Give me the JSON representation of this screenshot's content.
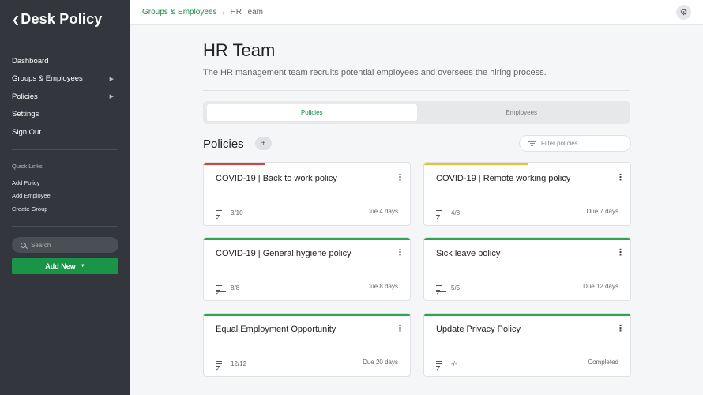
{
  "app": {
    "title": "Desk Policy"
  },
  "sidebar": {
    "nav": [
      {
        "label": "Dashboard",
        "has_children": false
      },
      {
        "label": "Groups & Employees",
        "has_children": true
      },
      {
        "label": "Policies",
        "has_children": true
      },
      {
        "label": "Settings",
        "has_children": false
      },
      {
        "label": "Sign Out",
        "has_children": false
      }
    ],
    "quick_links_title": "Quick Links",
    "quick_links": [
      "Add Policy",
      "Add Employee",
      "Create Group"
    ],
    "search_placeholder": "Search",
    "add_new_label": "Add New"
  },
  "breadcrumb": {
    "parent": "Groups & Employees",
    "current": "HR Team"
  },
  "page": {
    "title": "HR Team",
    "description": "The HR management team recruits potential employees and oversees the hiring process."
  },
  "tabs": [
    {
      "label": "Policies",
      "active": true
    },
    {
      "label": "Employees",
      "active": false
    }
  ],
  "policies": {
    "section_title": "Policies",
    "add_label": "+",
    "filter_placeholder": "Filter policies",
    "cards": [
      {
        "title": "COVID-19 | Back to work policy",
        "progress": "3/10",
        "due": "Due 4 days",
        "accent": "#d9403a",
        "accent_fraction": 0.3
      },
      {
        "title": "COVID-19 | Remote working policy",
        "progress": "4/8",
        "due": "Due 7 days",
        "accent": "#f0c02c",
        "accent_fraction": 0.5
      },
      {
        "title": "COVID-19 | General hygiene policy",
        "progress": "8/8",
        "due": "Due 8 days",
        "accent": "#2ea44f",
        "accent_fraction": 1.0
      },
      {
        "title": "Sick leave policy",
        "progress": "5/5",
        "due": "Due 12 days",
        "accent": "#2ea44f",
        "accent_fraction": 1.0
      },
      {
        "title": "Equal Employment Opportunity",
        "progress": "12/12",
        "due": "Due 20 days",
        "accent": "#2ea44f",
        "accent_fraction": 1.0
      },
      {
        "title": "Update Privacy Policy",
        "progress": "-/-",
        "due": "Completed",
        "accent": "#2ea44f",
        "accent_fraction": 1.0
      }
    ]
  },
  "colors": {
    "brand_green": "#1a9447",
    "sidebar_bg": "#33373d"
  },
  "icons": {
    "settings": "gear-icon",
    "search": "search-icon",
    "filter": "filter-icon",
    "task": "tasks-icon",
    "menu": "kebab-icon"
  }
}
